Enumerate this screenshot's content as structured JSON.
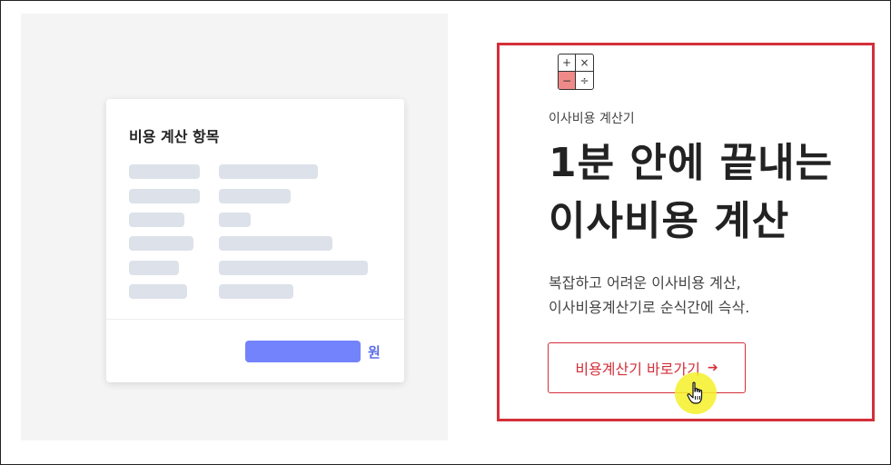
{
  "colors": {
    "accent_red": "#d32f3a",
    "result_bar": "#7383fb",
    "unit_text": "#5b6ee8",
    "calc_minus_bg": "#f08a88"
  },
  "card": {
    "title": "비용 계산 항목",
    "unit": "원"
  },
  "calc_icon": {
    "plus": "+",
    "times": "×",
    "minus": "−",
    "divide": "÷"
  },
  "hero": {
    "eyebrow": "이사비용 계산기",
    "headline_line1": "1분 안에 끝내는",
    "headline_line2": "이사비용 계산",
    "desc_line1": "복잡하고 어려운 이사비용 계산,",
    "desc_line2": "이사비용계산기로 순식간에 슥삭.",
    "cta_label": "비용계산기 바로가기",
    "cta_arrow": "➔"
  },
  "icons": {
    "cursor": "hand-pointer-icon"
  }
}
